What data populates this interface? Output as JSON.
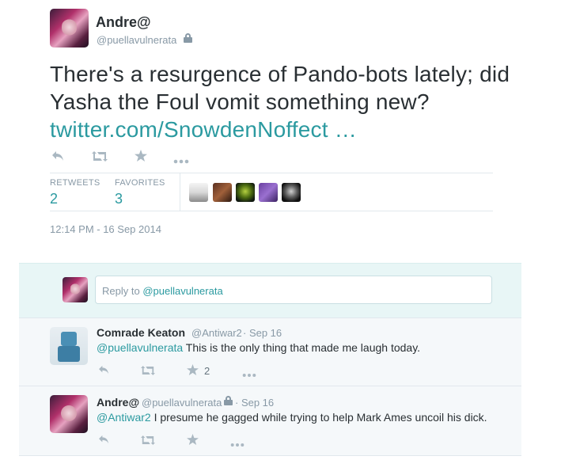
{
  "tweet": {
    "author_name": "Andre@",
    "author_handle": "@puellavulnerata",
    "text_before_link": "There's a resurgence of Pando-bots lately; did Yasha the Foul vomit something new? ",
    "link_text": "twitter.com/SnowdenNoffect …",
    "actions": {
      "reply_icon": "reply-icon",
      "retweet_icon": "retweet-icon",
      "favorite_icon": "star-icon",
      "more_icon": "more-icon"
    },
    "stats": {
      "retweets_label": "RETWEETS",
      "retweets_value": "2",
      "favorites_label": "FAVORITES",
      "favorites_value": "3"
    },
    "timestamp": "12:14 PM - 16 Sep 2014"
  },
  "reply_box": {
    "prefix": "Reply to ",
    "mention": "@puellavulnerata"
  },
  "replies": [
    {
      "name": "Comrade Keaton",
      "handle": "@Antiwar2",
      "date": "· Sep 16",
      "mention": "@puellavulnerata",
      "text": " This is the only thing that made me laugh today.",
      "favorite_count": "2"
    },
    {
      "name": "Andre@",
      "handle": "@puellavulnerata",
      "date": "· Sep 16",
      "mention": "@Antiwar2",
      "text": " I presume he gagged while trying to help Mark Ames uncoil his dick.",
      "favorite_count": ""
    }
  ],
  "colors": {
    "link": "#2b9aa0",
    "muted": "#8899a6",
    "text": "#292f33",
    "reply_box_bg": "#e8f6f6",
    "reply_bg": "#f5f8fa"
  }
}
